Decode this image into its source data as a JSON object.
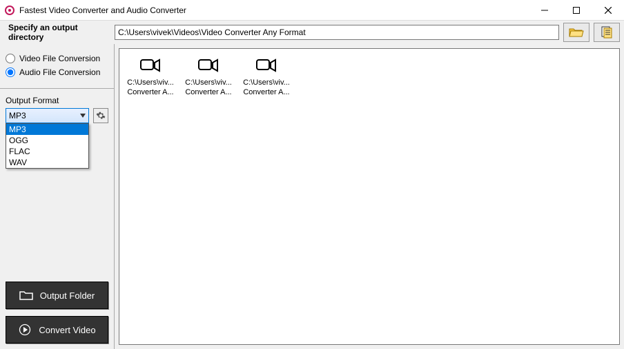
{
  "window": {
    "title": "Fastest Video Converter and Audio Converter"
  },
  "dirbar": {
    "label": "Specify an output directory",
    "path": "C:\\Users\\vivek\\Videos\\Video Converter Any Format"
  },
  "radios": {
    "video": "Video File Conversion",
    "audio": "Audio File Conversion",
    "selected": "audio"
  },
  "format": {
    "label": "Output Format",
    "selected": "MP3",
    "options": [
      "MP3",
      "OGG",
      "FLAC",
      "WAV"
    ]
  },
  "buttons": {
    "output_folder": "Output Folder",
    "convert": "Convert Video"
  },
  "files": [
    {
      "line1": "C:\\Users\\viv...",
      "line2": "Converter A..."
    },
    {
      "line1": "C:\\Users\\viv...",
      "line2": "Converter A..."
    },
    {
      "line1": "C:\\Users\\viv...",
      "line2": "Converter A..."
    }
  ]
}
